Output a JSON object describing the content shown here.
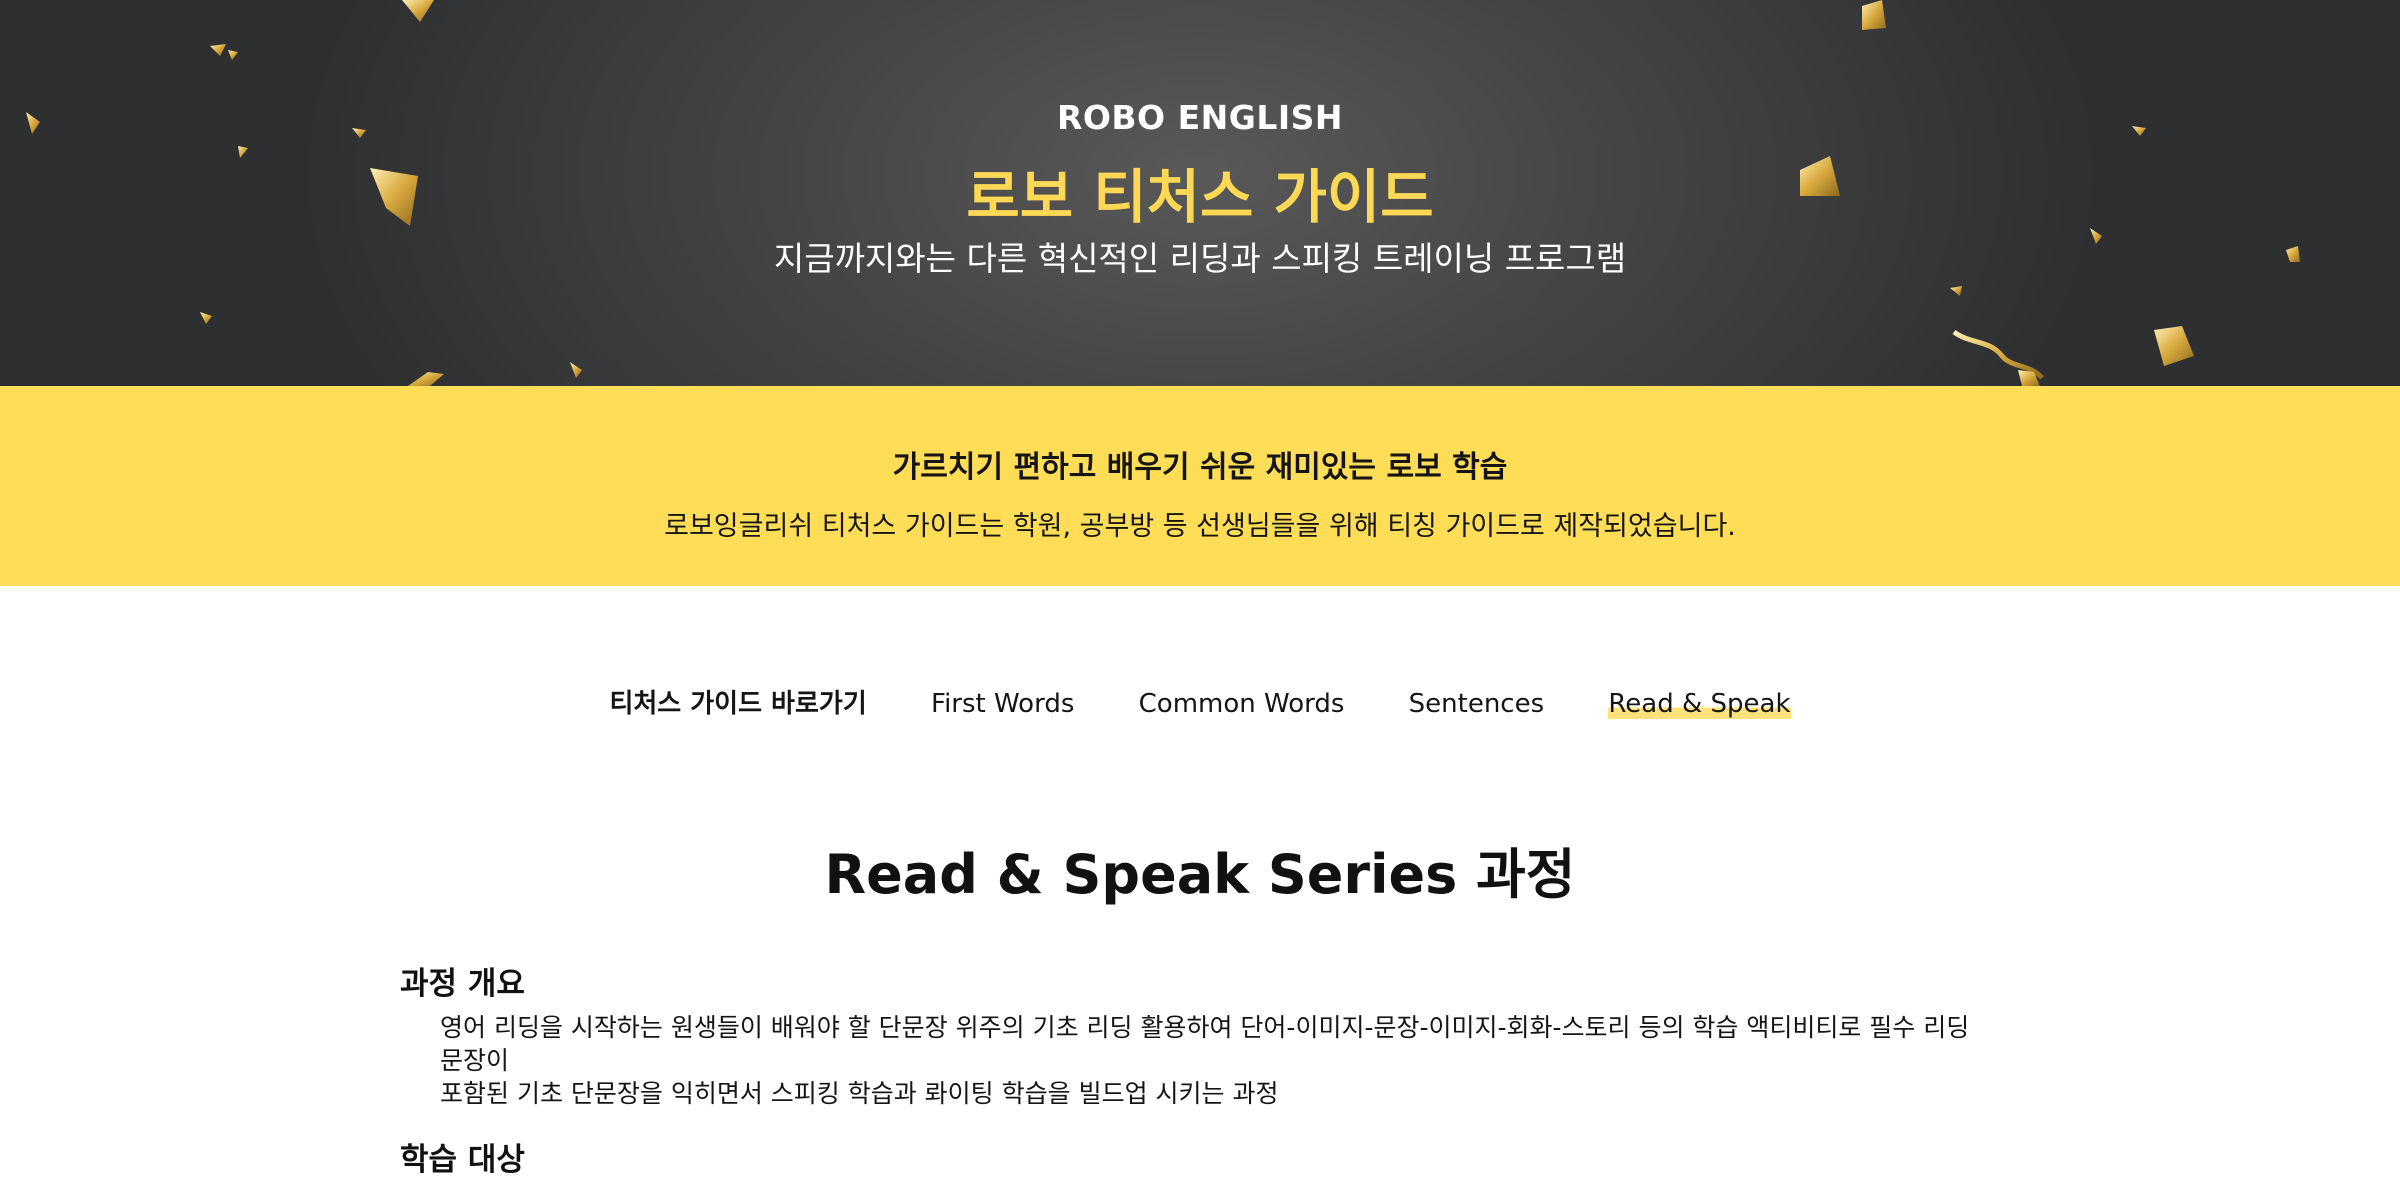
{
  "hero": {
    "eyebrow": "ROBO ENGLISH",
    "title": "로보 티처스 가이드",
    "subtitle": "지금까지와는 다른 혁신적인 리딩과 스피킹 트레이닝 프로그램",
    "accent_color": "#ffd955"
  },
  "band": {
    "title": "가르치기 편하고 배우기 쉬운 재미있는 로보 학습",
    "subtitle": "로보잉글리쉬 티처스 가이드는 학원, 공부방 등 선생님들을 위해 티칭 가이드로 제작되었습니다.",
    "color": "#ffdd57"
  },
  "nav": {
    "title": "티처스 가이드 바로가기",
    "items": [
      {
        "label": "First Words",
        "active": false
      },
      {
        "label": "Common Words",
        "active": false
      },
      {
        "label": "Sentences",
        "active": false
      },
      {
        "label": "Read & Speak",
        "active": true
      }
    ]
  },
  "main": {
    "title": "Read & Speak Series 과정",
    "sections": [
      {
        "heading": "과정 개요",
        "body_lines": [
          "영어 리딩을 시작하는 원생들이 배워야 할 단문장 위주의 기초 리딩 활용하여 단어-이미지-문장-이미지-회화-스토리 등의 학습 액티비티로 필수 리딩 문장이",
          "포함된 기초 단문장을 익히면서 스피킹 학습과 롸이팅 학습을 빌드업 시키는 과정"
        ]
      },
      {
        "heading": "학습 대상"
      }
    ]
  }
}
